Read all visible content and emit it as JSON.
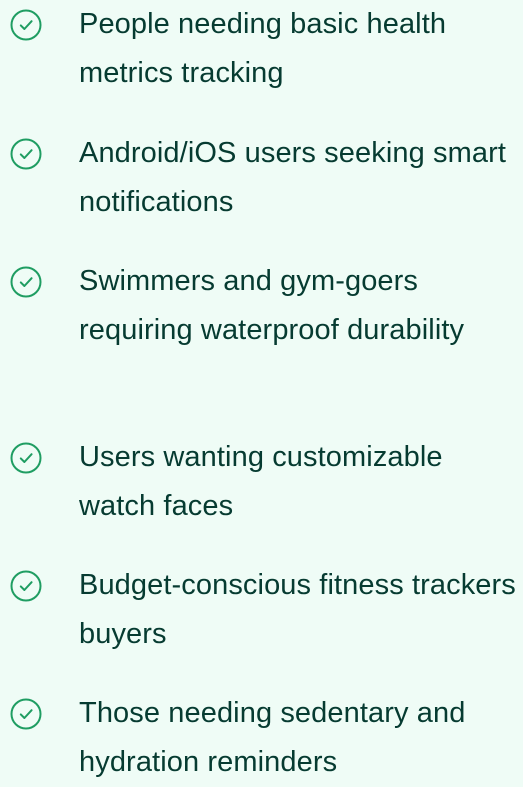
{
  "colors": {
    "background": "#effcf6",
    "text": "#063b31",
    "icon": "#1f9d62"
  },
  "items": [
    {
      "icon": "check-circle-icon",
      "text": "People needing basic health metrics tracking"
    },
    {
      "icon": "check-circle-icon",
      "text": "Android/iOS users seeking smart notifications"
    },
    {
      "icon": "check-circle-icon",
      "text": "Swimmers and gym-goers requiring waterproof durability"
    },
    {
      "icon": "check-circle-icon",
      "text": "Users wanting customizable watch faces"
    },
    {
      "icon": "check-circle-icon",
      "text": "Budget-conscious fitness trackers buyers"
    },
    {
      "icon": "check-circle-icon",
      "text": "Those needing sedentary and hydration reminders"
    }
  ]
}
